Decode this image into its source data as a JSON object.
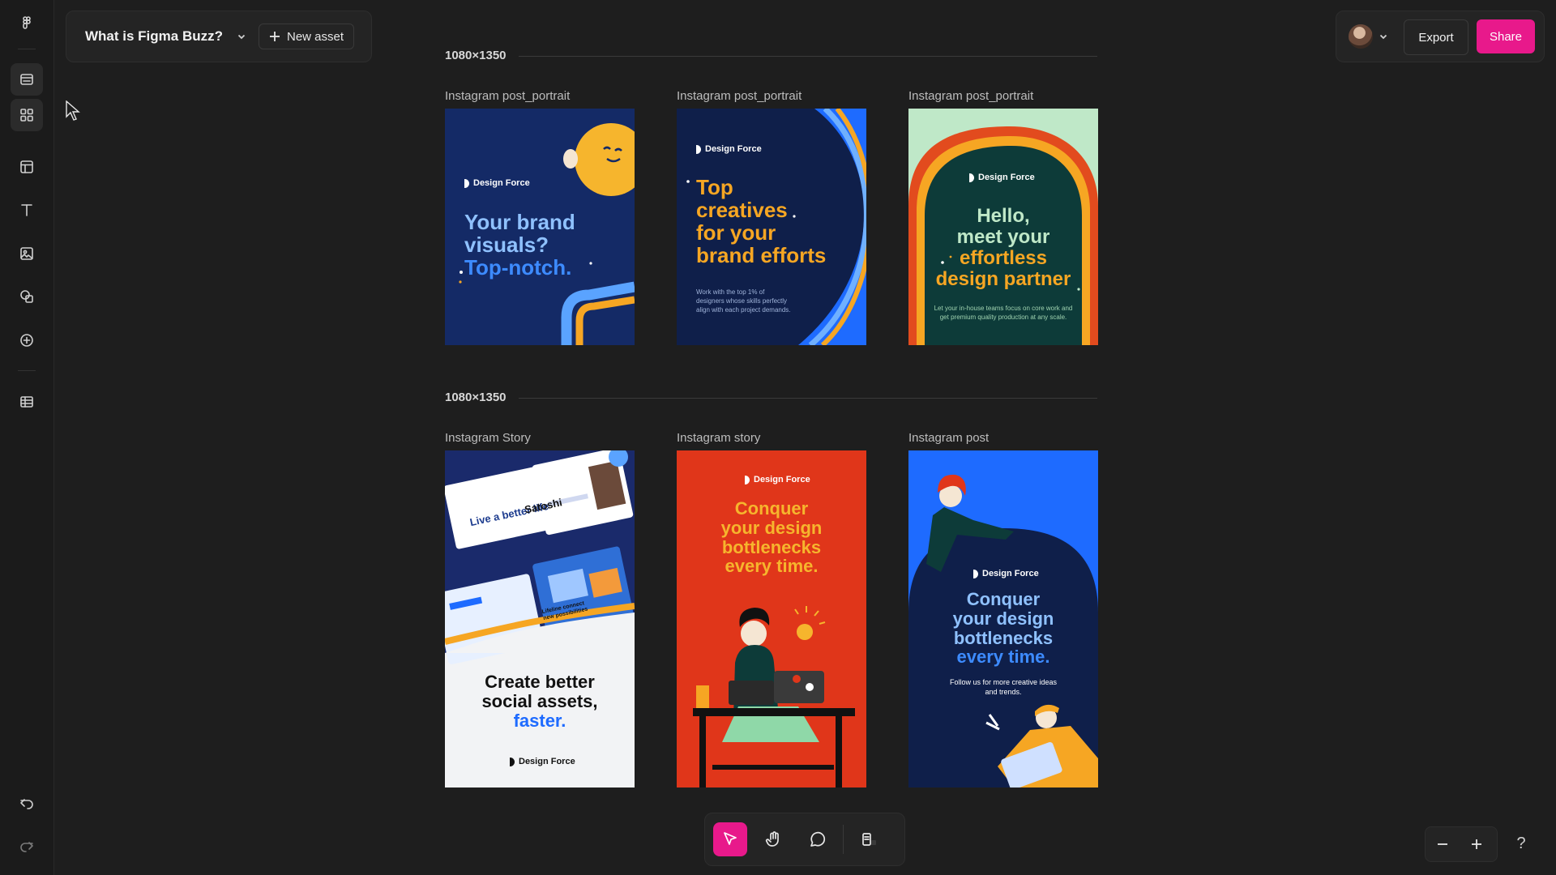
{
  "file": {
    "title": "What is Figma Buzz?",
    "new_asset_label": "New asset"
  },
  "header_right": {
    "export_label": "Export",
    "share_label": "Share"
  },
  "sections": [
    {
      "label": "1080×1350"
    },
    {
      "label": "1080×1350"
    }
  ],
  "cards": [
    {
      "label": "Instagram post_portrait",
      "brand": "Design Force",
      "headline": [
        "Your brand",
        "visuals?",
        "Top-notch."
      ],
      "subtext": ""
    },
    {
      "label": "Instagram post_portrait",
      "brand": "Design Force",
      "headline": [
        "Top",
        "creatives",
        "for your",
        "brand efforts"
      ],
      "subtext": "Work with the top 1% of designers whose skills perfectly align with each project demands."
    },
    {
      "label": "Instagram post_portrait",
      "brand": "Design Force",
      "headline": [
        "Hello,",
        "meet your",
        "effortless",
        "design partner"
      ],
      "subtext": "Let your in-house teams focus on core work and get premium quality production at any scale."
    },
    {
      "label": "Instagram Story",
      "brand": "Design Force",
      "headline": [
        "Create better",
        "social assets,",
        "faster."
      ],
      "collage": {
        "t1": "Live a better life",
        "t2": "Satoshi",
        "t3": "Lifeline connect new possibilities"
      },
      "subtext": ""
    },
    {
      "label": "Instagram story",
      "brand": "Design Force",
      "headline": [
        "Conquer",
        "your design",
        "bottlenecks",
        "every time."
      ],
      "subtext": ""
    },
    {
      "label": "Instagram post",
      "brand": "Design Force",
      "headline": [
        "Conquer",
        "your design",
        "bottlenecks",
        "every time."
      ],
      "subtext": "Follow us for more creative ideas and trends."
    }
  ],
  "colors": {
    "accent": "#e8198b",
    "navy": "#142a66",
    "dark_navy": "#0f1f4a",
    "blue": "#1e6bff",
    "green_bg": "#bfe8c8",
    "dark_green": "#0d3b39",
    "orange": "#f6a623",
    "red": "#e0361a"
  },
  "icons": {
    "left_toolbar": [
      "figma-logo-icon",
      "layers-icon",
      "assets-grid-icon",
      "layout-template-icon",
      "text-icon",
      "image-icon",
      "shapes-icon",
      "plus-circle-icon",
      "table-icon",
      "undo-icon",
      "redo-icon"
    ],
    "bottom_toolbar": [
      "select-arrow-icon",
      "hand-icon",
      "comment-icon",
      "widget-icon"
    ]
  }
}
